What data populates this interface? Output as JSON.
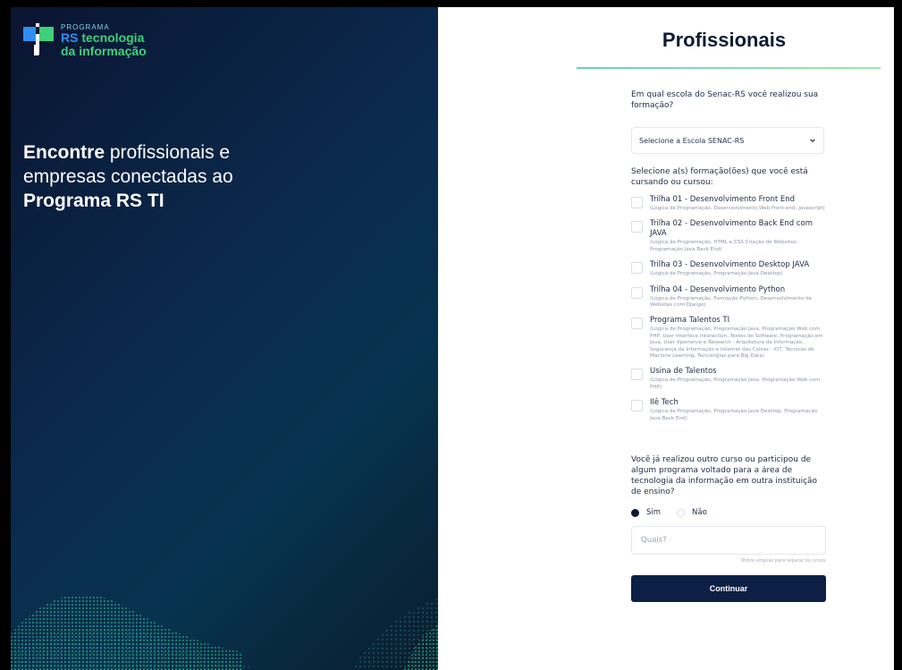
{
  "brand": {
    "line1": "PROGRAMA",
    "line2_rs": "RS",
    "line2_rest": " tecnologia",
    "line3": "da informação",
    "icon": "rs-ti-logo-icon"
  },
  "hero": {
    "word1": "Encontre",
    "text1": " profissionais e empresas conectadas ao ",
    "word2": "Programa RS TI"
  },
  "form": {
    "title": "Profissionais",
    "q_school": "Em qual escola do Senac-RS você realizou sua formação?",
    "school_select": "Selecione a Escola SENAC-RS",
    "q_courses": "Selecione a(s) formação(ões) que você está cursando ou cursou:",
    "courses": [
      {
        "title": "Trilha 01 - Desenvolvimento Front End",
        "desc": "(Lógica de Programação, Desenvolvimento Web Front-end, Javascript)"
      },
      {
        "title": "Trilha 02 - Desenvolvimento Back End com JAVA",
        "desc": "(Lógica de Programação, HTML e CSS Criação de Websites, Programação Java Back End)"
      },
      {
        "title": "Trilha 03 - Desenvolvimento Desktop JAVA",
        "desc": "(Lógica de Programação, Programação Java Desktop)"
      },
      {
        "title": "Trilha 04 - Desenvolvimento Python",
        "desc": "(Lógica de Programação, Formação Python, Desenvolvimento de Websites com Django)"
      },
      {
        "title": "Programa Talentos TI",
        "desc": "(Lógica de Programação, Programação Java, Programação Web com PHP, User Interface Interaction, Testes de Software, Programação em Java, User Xperience e Research - Arquitetura da Informação, Segurança da Informação e Internet das Coisas - IOT, Tecnicas de Machine Learning, Tecnologias para Big Data)"
      },
      {
        "title": "Usina de Talentos",
        "desc": "(Lógica de Programação, Programação Java, Programação Web com PHP)"
      },
      {
        "title": "Ilê Tech",
        "desc": "(Lógica de Programação, Programação Java Desktop, Programação Java Back End)"
      }
    ],
    "q_other": "Você já realizou outro curso ou participou de algum programa voltado para a área de tecnologia da informação em outra instituição de ensino?",
    "radio_yes": "Sim",
    "radio_no": "Não",
    "radio_selected": "Sim",
    "other_placeholder": "Quais?",
    "other_value": "",
    "hint": "Utilize vírgulas para separar os cursos",
    "submit": "Continuar"
  },
  "colors": {
    "primary": "#0c1f45",
    "accent_green": "#3ed17a",
    "accent_blue": "#2f8ff0",
    "rule": "#66d3b9"
  }
}
